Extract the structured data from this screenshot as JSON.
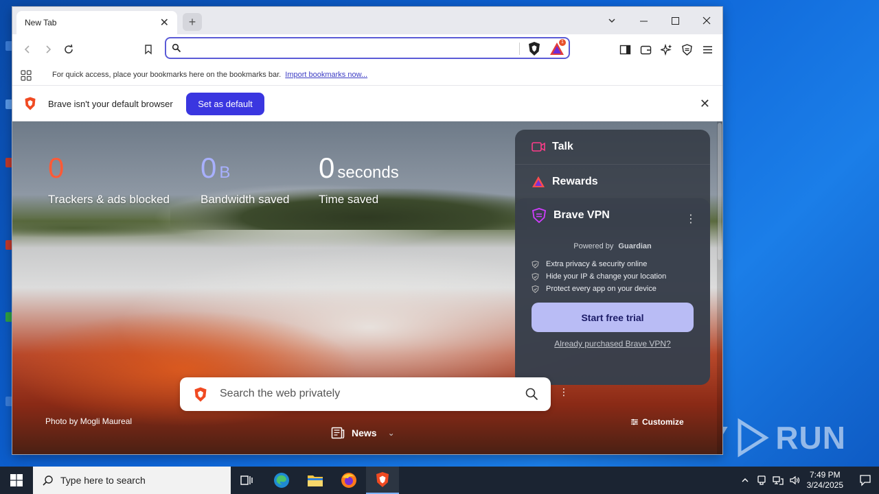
{
  "browser": {
    "tab_title": "New Tab",
    "new_tab": "+",
    "bookmarks_bar": {
      "message": "For quick access, place your bookmarks here on the bookmarks bar.",
      "import_link": "Import bookmarks now..."
    },
    "shields_badge": "1",
    "infobar": {
      "text": "Brave isn't your default browser",
      "button": "Set as default"
    }
  },
  "stats": [
    {
      "value": "0",
      "unit": "",
      "label": "Trackers & ads blocked",
      "color": "#ff5a36"
    },
    {
      "value": "0",
      "unit": "B",
      "label": "Bandwidth saved",
      "color": "#a8b0ff"
    },
    {
      "value": "0",
      "unit": "seconds",
      "label": "Time saved",
      "color": "#ffffff"
    }
  ],
  "widgets": {
    "talk": "Talk",
    "rewards": "Rewards",
    "vpn": {
      "title": "Brave VPN",
      "powered_by": "Powered by",
      "partner": "Guardian",
      "features": [
        "Extra privacy & security online",
        "Hide your IP & change your location",
        "Protect every app on your device"
      ],
      "cta": "Start free trial",
      "already": "Already purchased Brave VPN?"
    }
  },
  "search": {
    "placeholder": "Search the web privately"
  },
  "photo_credit": "Photo by Mogli Maureal",
  "news_label": "News",
  "customize_label": "Customize",
  "taskbar": {
    "search_placeholder": "Type here to search",
    "time": "7:49 PM",
    "date": "3/24/2025"
  },
  "colors": {
    "accent": "#3a36e0",
    "vpn_button": "#b9bcf5"
  }
}
